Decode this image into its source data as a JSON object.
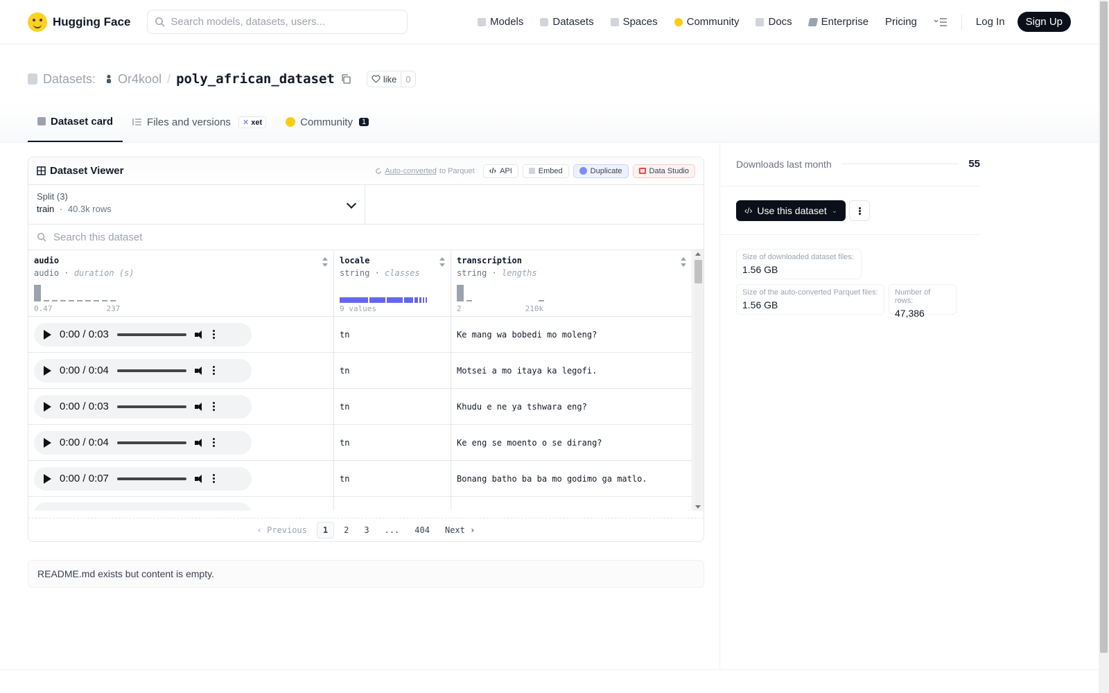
{
  "nav": {
    "brand": "Hugging Face",
    "search_placeholder": "Search models, datasets, users...",
    "links": [
      {
        "label": "Models",
        "icon": "cube-icon",
        "color": "#9ca3af"
      },
      {
        "label": "Datasets",
        "icon": "database-icon",
        "color": "#9ca3af"
      },
      {
        "label": "Spaces",
        "icon": "grid-icon",
        "color": "#9ca3af"
      },
      {
        "label": "Community",
        "icon": "hug-icon",
        "color": "#facc15"
      },
      {
        "label": "Docs",
        "icon": "book-icon",
        "color": "#9ca3af"
      },
      {
        "label": "Enterprise",
        "icon": "enterprise-icon",
        "color": "#9ca3af"
      },
      {
        "label": "Pricing",
        "icon": "",
        "color": ""
      }
    ],
    "login": "Log In",
    "signup": "Sign Up"
  },
  "header": {
    "section": "Datasets:",
    "owner": "Or4kool",
    "separator": "/",
    "name": "poly_african_dataset",
    "like_label": "like",
    "like_count": "0"
  },
  "tabs": [
    {
      "label": "Dataset card",
      "active": true
    },
    {
      "label": "Files and versions",
      "badge": "xet"
    },
    {
      "label": "Community",
      "count": "1"
    }
  ],
  "viewer": {
    "title": "Dataset Viewer",
    "auto_converted": "Auto-converted",
    "to_parquet": "to Parquet",
    "buttons": {
      "api": "API",
      "embed": "Embed",
      "duplicate": "Duplicate",
      "studio": "Data Studio"
    },
    "split_label": "Split (3)",
    "split_value": "train",
    "split_rows": "40.3k rows",
    "search_placeholder": "Search this dataset",
    "columns": [
      {
        "name": "audio",
        "type": "audio",
        "stat": "duration (s)",
        "min": "0.47",
        "max": "237"
      },
      {
        "name": "locale",
        "type": "string",
        "stat": "classes",
        "summary": "9 values"
      },
      {
        "name": "transcription",
        "type": "string",
        "stat": "lengths",
        "min": "2",
        "max": "210k"
      }
    ],
    "rows": [
      {
        "audio": "0:00 / 0:03",
        "locale": "tn",
        "transcription": "Ke mang wa bobedi mo moleng?"
      },
      {
        "audio": "0:00 / 0:04",
        "locale": "tn",
        "transcription": "Motsei a mo itaya ka legofi."
      },
      {
        "audio": "0:00 / 0:03",
        "locale": "tn",
        "transcription": "Khudu e ne ya tshwara eng?"
      },
      {
        "audio": "0:00 / 0:04",
        "locale": "tn",
        "transcription": "Ke eng se moento o se dirang?"
      },
      {
        "audio": "0:00 / 0:07",
        "locale": "tn",
        "transcription": "Bonang batho ba ba mo godimo ga matlo."
      }
    ],
    "pager": {
      "previous": "Previous",
      "pages": [
        "1",
        "2",
        "3",
        "...",
        "404"
      ],
      "next": "Next"
    }
  },
  "readme": "README.md exists but content is empty.",
  "sidebar": {
    "downloads_label": "Downloads last month",
    "downloads_value": "55",
    "use_button": "Use this dataset",
    "stats": [
      {
        "label": "Size of downloaded dataset files:",
        "value": "1.56 GB"
      },
      {
        "label": "Size of the auto-converted Parquet files:",
        "value": "1.56 GB"
      },
      {
        "label": "Number of rows:",
        "value": "47,386"
      }
    ]
  }
}
